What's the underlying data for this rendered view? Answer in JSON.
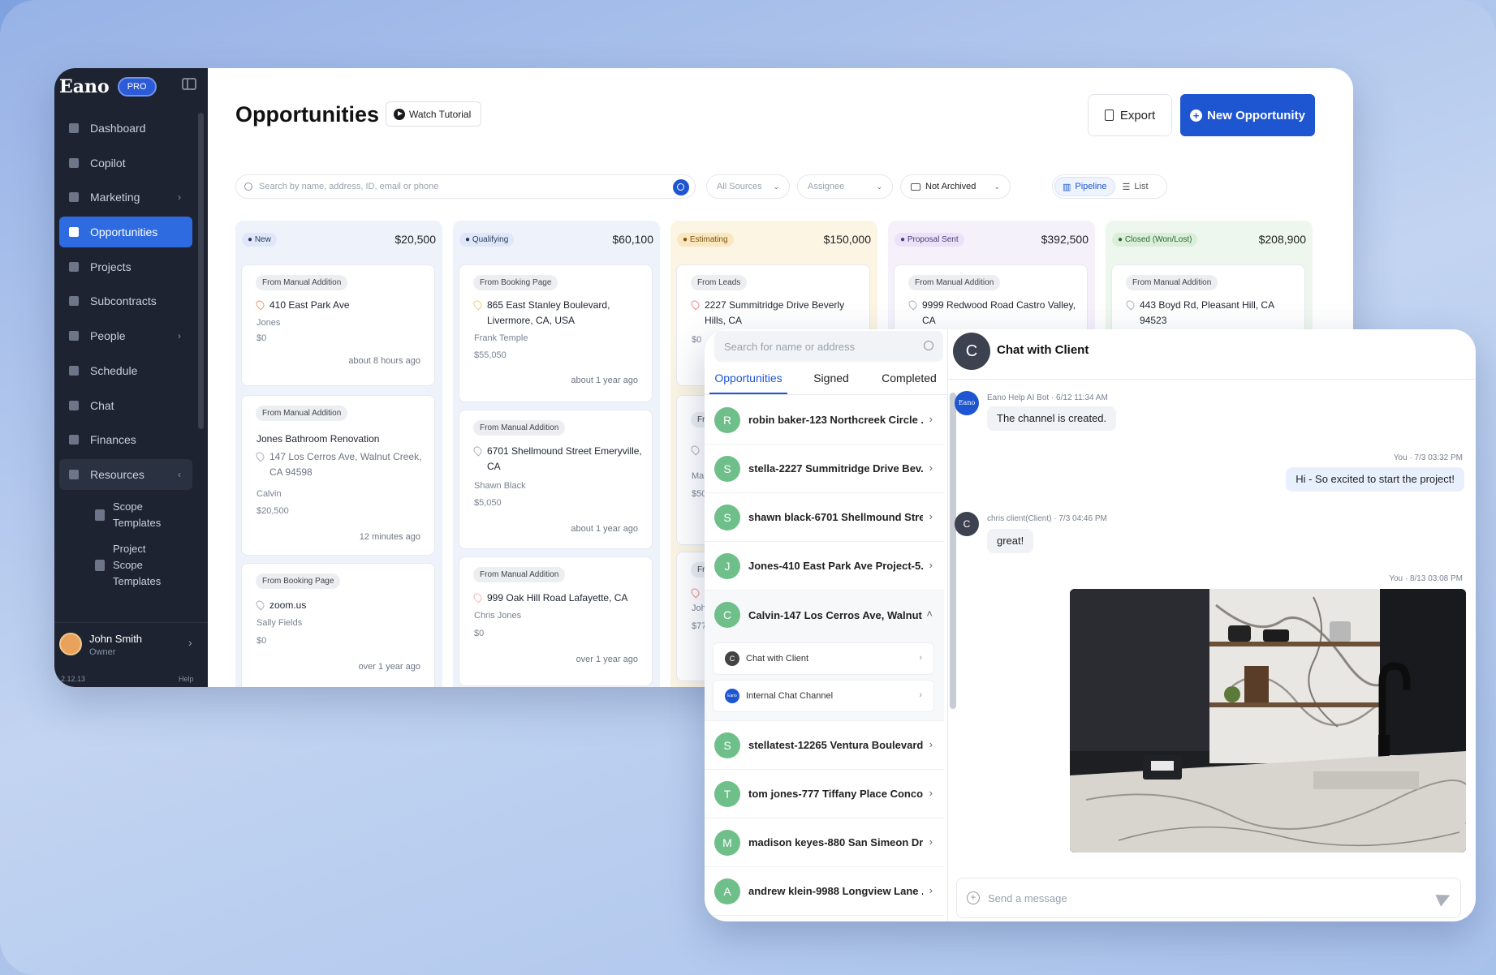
{
  "app": {
    "name": "Eano",
    "badge": "PRO",
    "version": "2.12.13",
    "help": "Help"
  },
  "sidebar": {
    "items": [
      {
        "label": "Dashboard",
        "icon": "dashboard-icon"
      },
      {
        "label": "Copilot",
        "icon": "copilot-icon"
      },
      {
        "label": "Marketing",
        "icon": "marketing-icon"
      },
      {
        "label": "Opportunities",
        "icon": "trend-icon"
      },
      {
        "label": "Projects",
        "icon": "list-icon"
      },
      {
        "label": "Subcontracts",
        "icon": "doc-icon"
      },
      {
        "label": "People",
        "icon": "people-icon"
      },
      {
        "label": "Schedule",
        "icon": "clock-icon"
      },
      {
        "label": "Chat",
        "icon": "chat-icon"
      },
      {
        "label": "Finances",
        "icon": "dollar-icon"
      },
      {
        "label": "Resources",
        "icon": "book-icon"
      }
    ],
    "sub_items": [
      "Scope Templates",
      "Project Scope Templates"
    ],
    "user": {
      "name": "John Smith",
      "role": "Owner"
    }
  },
  "header": {
    "title": "Opportunities",
    "tutorial": "Watch Tutorial",
    "export": "Export",
    "new": "New Opportunity"
  },
  "filters": {
    "search_placeholder": "Search by name, address, ID, email or phone",
    "sources": "All Sources",
    "assignee": "Assignee",
    "archive": "Not Archived",
    "view_pipeline": "Pipeline",
    "view_list": "List"
  },
  "columns": [
    {
      "stage": "New",
      "total": "$20,500",
      "color": "#e9effb",
      "cards": [
        {
          "source": "From Manual Addition",
          "title": "",
          "address": "410 East Park Ave",
          "person": "Jones",
          "amount": "$0",
          "time": "about 8 hours ago"
        },
        {
          "source": "From Manual Addition",
          "title": "Jones Bathroom Renovation",
          "address": "147 Los Cerros Ave, Walnut Creek, CA 94598",
          "person": "Calvin",
          "amount": "$20,500",
          "time": "12 minutes ago"
        },
        {
          "source": "From Booking Page",
          "title": "",
          "address": "zoom.us",
          "person": "Sally Fields",
          "amount": "$0",
          "time": "over 1 year ago"
        }
      ]
    },
    {
      "stage": "Qualifying",
      "total": "$60,100",
      "color": "#eaeffb",
      "cards": [
        {
          "source": "From Booking Page",
          "title": "",
          "address": "865 East Stanley Boulevard, Livermore, CA, USA",
          "person": "Frank Temple",
          "amount": "$55,050",
          "time": "about 1 year ago"
        },
        {
          "source": "From Manual Addition",
          "title": "",
          "address": "6701 Shellmound Street Emeryville, CA",
          "person": "Shawn Black",
          "amount": "$5,050",
          "time": "about 1 year ago"
        },
        {
          "source": "From Manual Addition",
          "title": "",
          "address": "999 Oak Hill Road Lafayette, CA",
          "person": "Chris Jones",
          "amount": "$0",
          "time": "over 1 year ago"
        }
      ]
    },
    {
      "stage": "Estimating",
      "total": "$150,000",
      "color": "#fdf6e6",
      "cards": [
        {
          "source": "From Leads",
          "title": "",
          "address": "2227 Summitridge Drive Beverly Hills, CA",
          "person": "",
          "amount": "$0",
          "time": ""
        }
      ]
    },
    {
      "stage": "Proposal Sent",
      "total": "$392,500",
      "color": "#f5f1fb",
      "cards": [
        {
          "source": "From Manual Addition",
          "title": "",
          "address": "9999 Redwood Road Castro Valley, CA",
          "person": "",
          "amount": "",
          "time": ""
        }
      ]
    },
    {
      "stage": "Closed (Won/Lost)",
      "total": "$208,900",
      "color": "#eef7ee",
      "cards": [
        {
          "source": "From Manual Addition",
          "title": "",
          "address": "443 Boyd Rd, Pleasant Hill, CA 94523",
          "person": "",
          "amount": "",
          "time": ""
        }
      ]
    }
  ],
  "peek": {
    "c3_src1": "Fr",
    "c3_meta1": "Ma",
    "c3_meta2": "$50",
    "c3_src2": "Fr",
    "c3_meta3": "Joh",
    "c3_meta4": "$77"
  },
  "chat_panel": {
    "search_placeholder": "Search for name or address",
    "tabs": [
      "Opportunities",
      "Signed",
      "Completed"
    ],
    "conversations": [
      {
        "initial": "R",
        "name": "robin baker-123 Northcreek Circle ..."
      },
      {
        "initial": "S",
        "name": "stella-2227 Summitridge Drive Bev..."
      },
      {
        "initial": "S",
        "name": "shawn black-6701 Shellmound Stre..."
      },
      {
        "initial": "J",
        "name": "Jones-410 East Park Ave Project-5..."
      },
      {
        "initial": "C",
        "name": "Calvin-147 Los Cerros Ave, Walnut ..."
      },
      {
        "initial": "S",
        "name": "stellatest-12265 Ventura Boulevard ..."
      },
      {
        "initial": "T",
        "name": "tom jones-777 Tiffany Place Conco..."
      },
      {
        "initial": "M",
        "name": "madison keyes-880 San Simeon Dr..."
      },
      {
        "initial": "A",
        "name": "andrew klein-9988 Longview Lane ..."
      }
    ],
    "subchannels": [
      {
        "mini": "C",
        "label": "Chat with Client"
      },
      {
        "mini": "Eano",
        "label": "Internal Chat Channel"
      }
    ],
    "chat": {
      "avatar": "C",
      "title": "Chat with Client",
      "messages": [
        {
          "meta": "Eano Help AI Bot · 6/12 11:34 AM",
          "text": "The channel is created.",
          "avatar": "Eano"
        },
        {
          "meta": "You · 7/3 03:32 PM",
          "text": "Hi - So excited to start the project!"
        },
        {
          "meta": "chris client(Client) · 7/3 04:46 PM",
          "text": "great!",
          "avatar": "C"
        },
        {
          "meta": "You · 8/13 03:08 PM",
          "text": ""
        }
      ],
      "composer_placeholder": "Send a message"
    }
  }
}
